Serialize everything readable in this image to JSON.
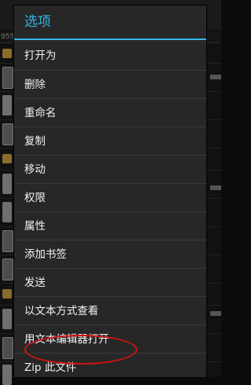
{
  "background": {
    "path_fragment": "955"
  },
  "dialog": {
    "title": "选项",
    "menu_items": [
      {
        "label": "打开为"
      },
      {
        "label": "删除"
      },
      {
        "label": "重命名"
      },
      {
        "label": "复制"
      },
      {
        "label": "移动"
      },
      {
        "label": "权限"
      },
      {
        "label": "属性"
      },
      {
        "label": "添加书签"
      },
      {
        "label": "发送"
      },
      {
        "label": "以文本方式查看"
      },
      {
        "label": "用文本编辑器打开"
      },
      {
        "label": "Zip 此文件"
      }
    ]
  },
  "colors": {
    "accent": "#33b5e5",
    "highlight_ring": "#d31212"
  }
}
